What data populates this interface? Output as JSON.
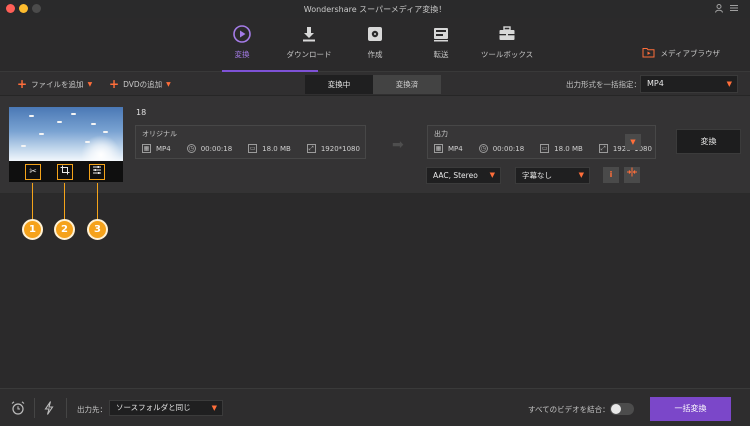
{
  "window": {
    "title": "Wondershare スーパーメディア変換！"
  },
  "nav": {
    "items": [
      {
        "label": "変換",
        "icon": "convert-icon",
        "active": true
      },
      {
        "label": "ダウンロード",
        "icon": "download-icon",
        "active": false
      },
      {
        "label": "作成",
        "icon": "burn-icon",
        "active": false
      },
      {
        "label": "転送",
        "icon": "transfer-icon",
        "active": false
      },
      {
        "label": "ツールボックス",
        "icon": "toolbox-icon",
        "active": false
      }
    ],
    "media_browser_label": "メディアブラウザ",
    "accent_color": "#7e52d6"
  },
  "toolbar": {
    "add_files_label": "ファイルを追加",
    "add_dvd_label": "DVDの追加",
    "tabs": [
      "変換中",
      "変換済"
    ],
    "active_tab": "変換中",
    "format_label": "出力形式を一括指定：",
    "format_value": "MP4"
  },
  "task": {
    "file_name": "18",
    "original": {
      "header": "オリジナル",
      "format": "MP4",
      "duration": "00:00:18",
      "size": "18.0 MB",
      "resolution": "1920*1080"
    },
    "output": {
      "header": "出力",
      "format": "MP4",
      "duration": "00:00:18",
      "size": "18.0 MB",
      "resolution": "1920*1080"
    },
    "convert_label": "変換",
    "audio_value": "AAC, Stereo",
    "subtitle_value": "字幕なし",
    "callouts": [
      "1",
      "2",
      "3"
    ],
    "callout_color": "#f5a21b"
  },
  "footer": {
    "output_label": "出力先：",
    "output_value": "ソースフォルダと同じ",
    "merge_label": "すべてのビデオを結合：",
    "batch_convert_label": "一括変換",
    "button_color": "#7b47c9"
  }
}
